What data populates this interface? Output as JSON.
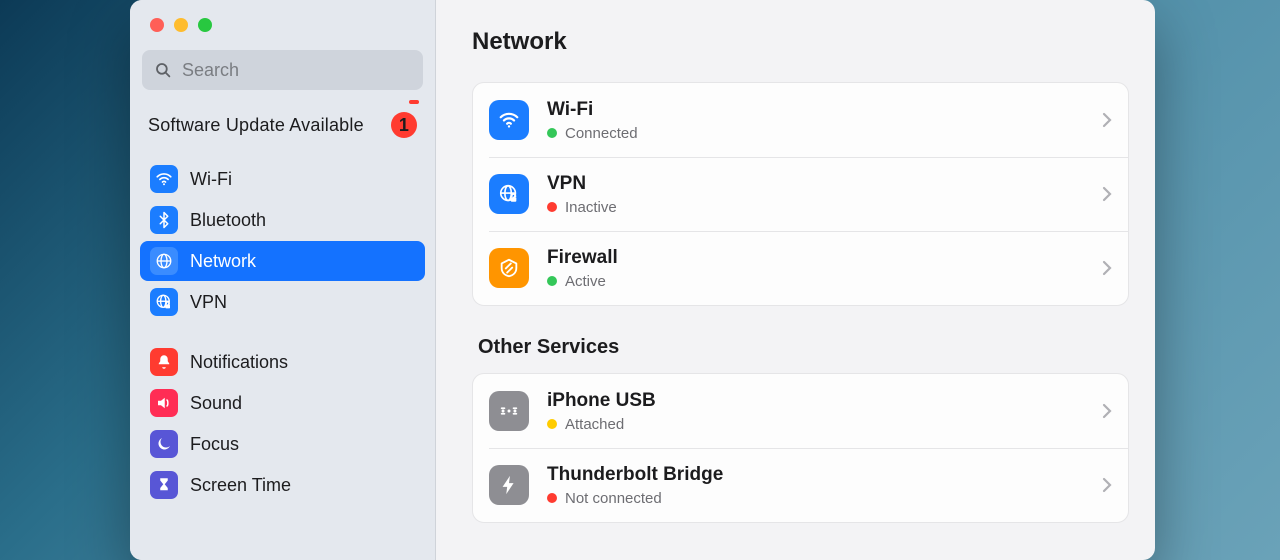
{
  "search": {
    "placeholder": "Search"
  },
  "update_notice": {
    "label": "Software Update Available",
    "count": "1"
  },
  "sidebar": {
    "group_a": [
      {
        "key": "wifi",
        "label": "Wi-Fi",
        "icon": "wifi",
        "selected": false
      },
      {
        "key": "bluetooth",
        "label": "Bluetooth",
        "icon": "bluetooth",
        "selected": false
      },
      {
        "key": "network",
        "label": "Network",
        "icon": "globe",
        "selected": true
      },
      {
        "key": "vpn",
        "label": "VPN",
        "icon": "vpn",
        "selected": false
      }
    ],
    "group_b": [
      {
        "key": "notifications",
        "label": "Notifications",
        "icon": "bell"
      },
      {
        "key": "sound",
        "label": "Sound",
        "icon": "sound"
      },
      {
        "key": "focus",
        "label": "Focus",
        "icon": "moon"
      },
      {
        "key": "screentime",
        "label": "Screen Time",
        "icon": "hourglass"
      }
    ]
  },
  "main": {
    "title": "Network",
    "primary": [
      {
        "key": "wifi",
        "title": "Wi-Fi",
        "status_label": "Connected",
        "status_color": "green",
        "icon": "wifi",
        "icon_bg": "blue"
      },
      {
        "key": "vpn",
        "title": "VPN",
        "status_label": "Inactive",
        "status_color": "red",
        "icon": "vpn",
        "icon_bg": "blue"
      },
      {
        "key": "firewall",
        "title": "Firewall",
        "status_label": "Active",
        "status_color": "green",
        "icon": "firewall",
        "icon_bg": "orange"
      }
    ],
    "other_title": "Other Services",
    "other": [
      {
        "key": "iphone-usb",
        "title": "iPhone USB",
        "status_label": "Attached",
        "status_color": "yellow",
        "icon": "iphone-usb",
        "icon_bg": "gray"
      },
      {
        "key": "tb-bridge",
        "title": "Thunderbolt Bridge",
        "status_label": "Not connected",
        "status_color": "red",
        "icon": "thunderbolt",
        "icon_bg": "gray"
      }
    ]
  }
}
